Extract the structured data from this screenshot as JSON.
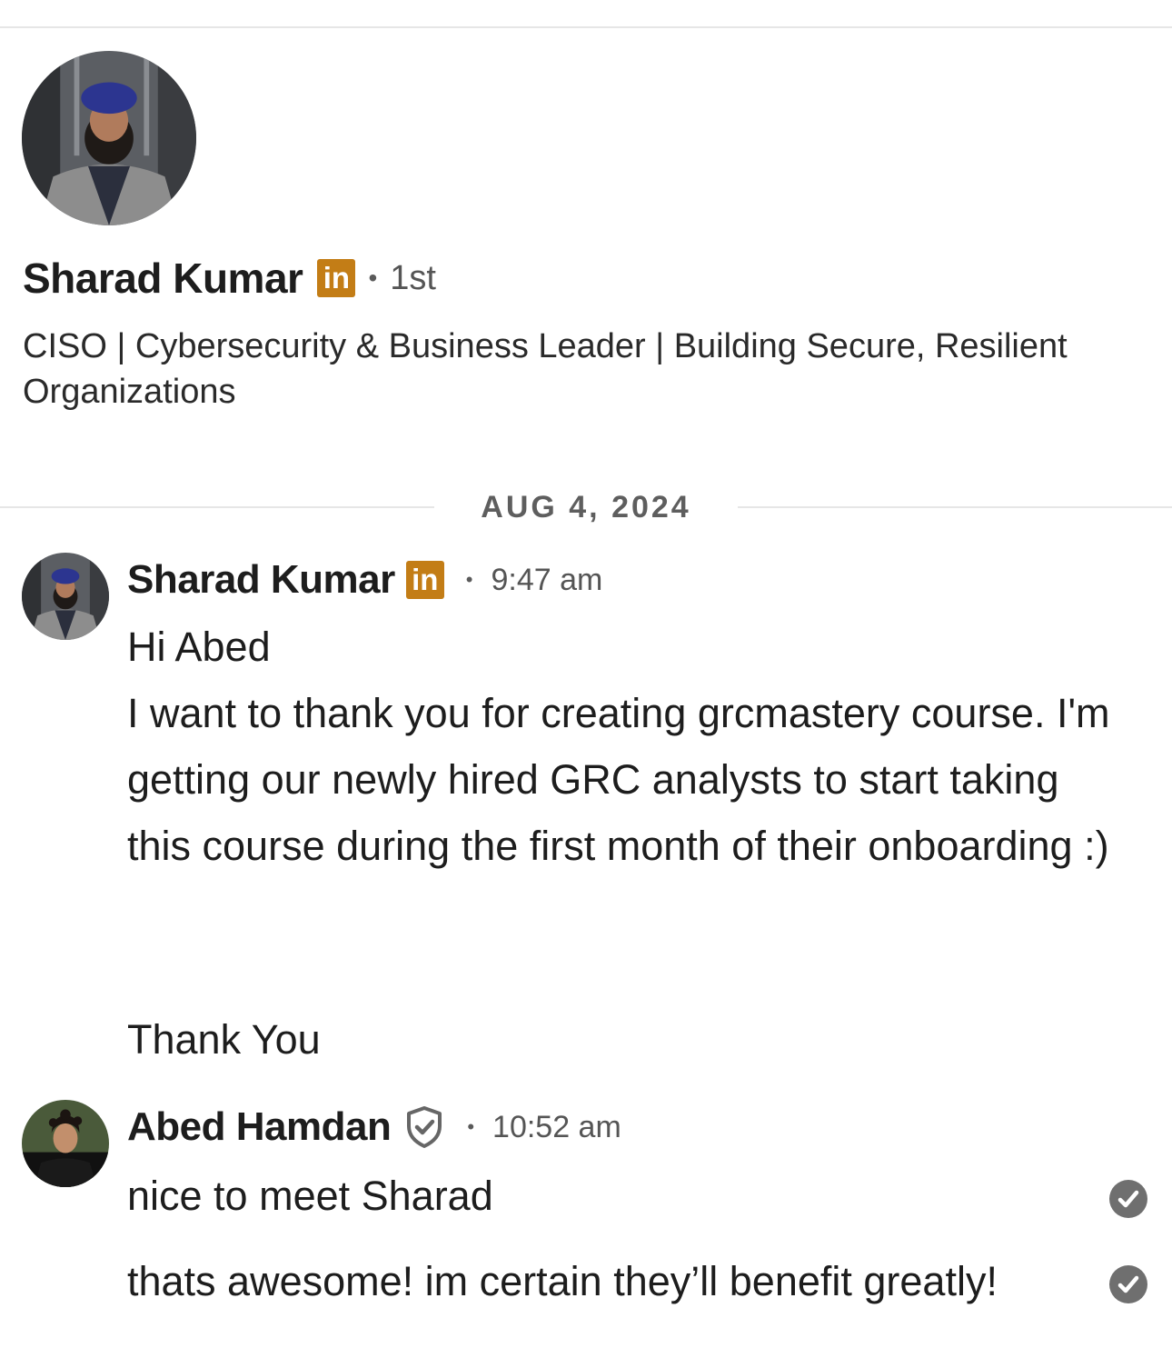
{
  "profile": {
    "name": "Sharad Kumar",
    "badge_text": "in",
    "degree": "1st",
    "headline": "CISO | Cybersecurity & Business Leader | Building Secure, Resilient Organizations"
  },
  "conversation": {
    "date_divider": "AUG 4, 2024",
    "messages": [
      {
        "sender": "Sharad Kumar",
        "badge_text": "in",
        "time": "9:47 am",
        "lines": [
          "Hi Abed",
          "I want to thank you for creating grcmastery course. I'm getting our newly hired GRC analysts to start taking this course during the first month of their onboarding :)",
          "Thank You"
        ]
      },
      {
        "sender": "Abed Hamdan",
        "time": "10:52 am",
        "lines": [
          "nice to meet Sharad",
          "thats awesome! im certain they’ll benefit greatly!"
        ]
      }
    ]
  },
  "icons": {
    "linkedin_badge": "linkedin-badge-icon",
    "verified": "verified-shield-icon",
    "read_receipt": "check-circle-icon"
  },
  "colors": {
    "badge": "#c37d16",
    "text": "#1d1d1d",
    "muted": "#5e5e5e",
    "divider": "#e6e6e6",
    "check": "#6f6f6f"
  }
}
